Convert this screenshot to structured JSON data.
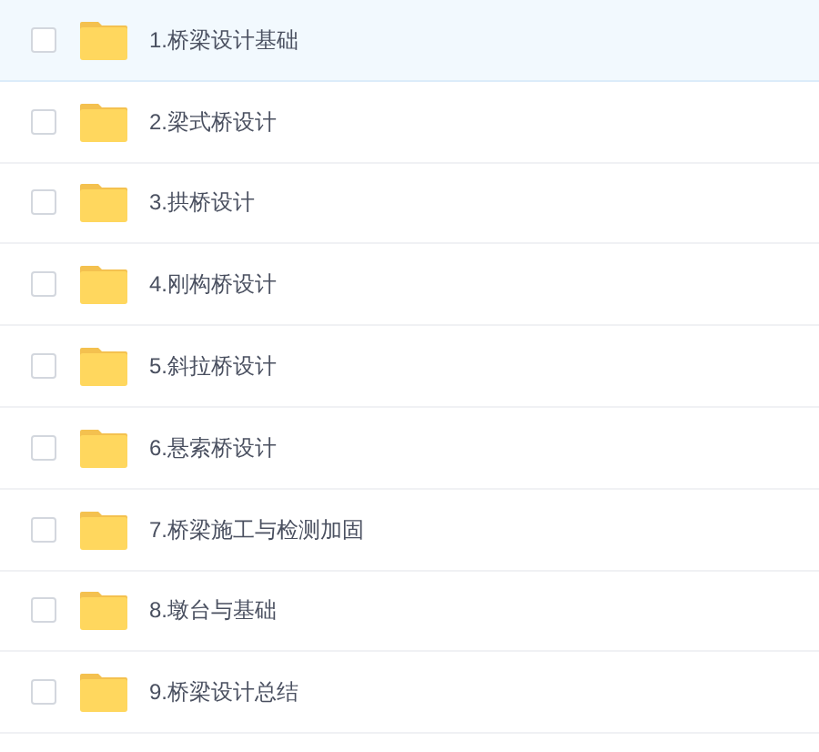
{
  "files": [
    {
      "name": "1.桥梁设计基础",
      "selected": true,
      "checked": false
    },
    {
      "name": "2.梁式桥设计",
      "selected": false,
      "checked": false
    },
    {
      "name": "3.拱桥设计",
      "selected": false,
      "checked": false
    },
    {
      "name": "4.刚构桥设计",
      "selected": false,
      "checked": false
    },
    {
      "name": "5.斜拉桥设计",
      "selected": false,
      "checked": false
    },
    {
      "name": "6.悬索桥设计",
      "selected": false,
      "checked": false
    },
    {
      "name": "7.桥梁施工与检测加固",
      "selected": false,
      "checked": false
    },
    {
      "name": "8.墩台与基础",
      "selected": false,
      "checked": false
    },
    {
      "name": "9.桥梁设计总结",
      "selected": false,
      "checked": false
    }
  ]
}
